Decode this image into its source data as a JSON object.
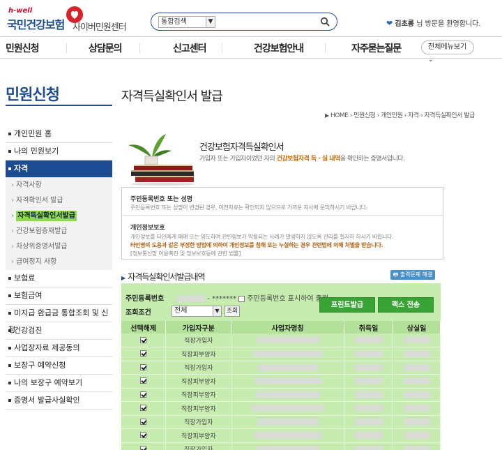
{
  "header": {
    "logo_hwell": "h-well",
    "logo_brand": "국민건강보험",
    "logo_service": "사이버민원센터",
    "search": {
      "scope": "통합검색",
      "value": ""
    },
    "welcome_name": "김초롱",
    "welcome_suffix": "님 방문을 환영합니다."
  },
  "topnav": {
    "items": [
      "민원신청",
      "상담문의",
      "신고센터",
      "건강보험안내",
      "자주묻는질문"
    ],
    "all_menu": "전체메뉴보기"
  },
  "sidebar": {
    "title": "민원신청",
    "items": [
      {
        "label": "개인민원 홈"
      },
      {
        "label": "나의 민원보기"
      },
      {
        "label": "자격"
      },
      {
        "label": "보험료"
      },
      {
        "label": "보험급여"
      },
      {
        "label": "미지급 환급금 통합조회 및 신청"
      },
      {
        "label": "건강검진"
      },
      {
        "label": "사업장자료 제공동의"
      },
      {
        "label": "보장구 예약신청"
      },
      {
        "label": "나의 보장구 예약보기"
      },
      {
        "label": "증명서 발급사실확인"
      }
    ],
    "subitems": [
      "자격사항",
      "자격확인서 발급",
      "자격득실확인서발급",
      "건강보험증재발급",
      "차상위증명서발급",
      "급여정지 사항"
    ]
  },
  "content": {
    "page_title": "자격득실확인서 발급",
    "breadcrumb": [
      "HOME",
      "민원신청",
      "개인민원",
      "자격",
      "자격득실확인서 발급"
    ],
    "banner": {
      "title": "건강보험자격득실확인서",
      "desc_pre": "가입자 또는 가입자이었던 자의 ",
      "desc_hl": "건강보험자격 득 · 실 내역",
      "desc_post": "을 확인하는 증명서입니다."
    },
    "notice": {
      "h1": "주민등록번호 또는 성명",
      "p1": "주민등록번호 또는 성명이 변경된 경우, 이전자료는 확인되지 않으므로 가까운 지사에 문의하시기 바랍니다.",
      "h2": "개인정보보호",
      "p2": "개인정보를 타인에게 매매 또는 양도하여 관련정보가 악용되는 사례가 발생하지 않도록 관리를 철저히 하시기 바랍니다.",
      "p3": "타인명의 도용과 같은 부정한 방법에 의하여 개인정보를 침해 또는 누설하는 경우 관련법에 의해 처벌을 받습니다.",
      "p4": "[정보통신망 이용촉진 및 정보보호등에 관한 법률]"
    },
    "section_title": "자격득실확인서발급내역",
    "download_label": "출력문제 해결",
    "form": {
      "rrn_label": "주민등록번호",
      "rrn_masked": "- *******",
      "rrn_show_label": "주민등록번호 표시하여 출력",
      "cond_label": "조회조건",
      "cond_value": "전체",
      "search_btn": "조회",
      "print_btn": "프린트발급",
      "fax_btn": "팩스 전송"
    },
    "table": {
      "headers": [
        "선택해제",
        "가입자구분",
        "사업자명칭",
        "취득일",
        "상실일"
      ],
      "rows": [
        "직장가입자",
        "직장피부양자",
        "직장가입자",
        "직장피부양자",
        "직장피부양자",
        "직장피부양자",
        "직장가입자",
        "직장피부양자",
        "직장가입자"
      ]
    }
  }
}
